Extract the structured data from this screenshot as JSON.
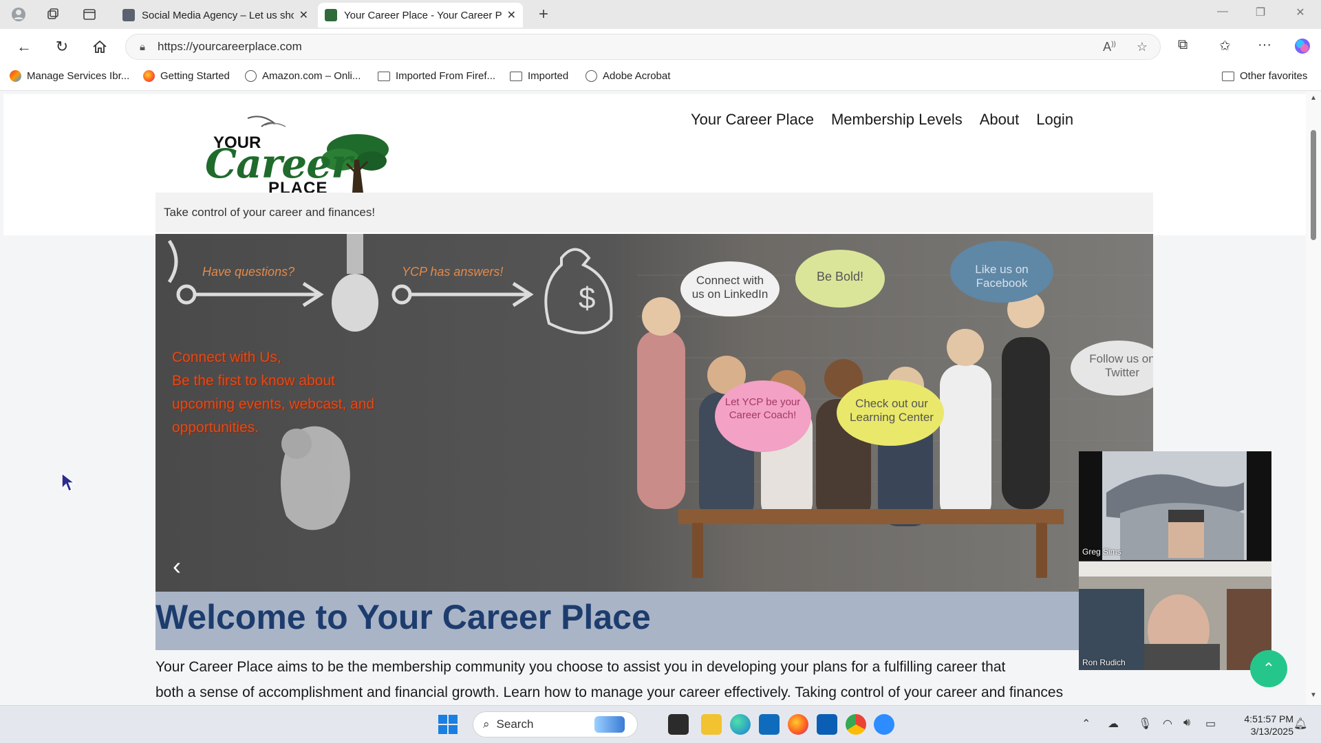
{
  "browser": {
    "tabs": [
      {
        "title": "Social Media Agency – Let us sho",
        "active": false
      },
      {
        "title": "Your Career Place - Your Career P",
        "active": true
      }
    ],
    "url": "https://yourcareerplace.com",
    "bookmarks": [
      {
        "label": "Manage Services Ibr...",
        "icon": "brand-icon"
      },
      {
        "label": "Getting Started",
        "icon": "firefox-icon"
      },
      {
        "label": "Amazon.com – Onli...",
        "icon": "globe-icon"
      },
      {
        "label": "Imported From Firef...",
        "icon": "folder-icon"
      },
      {
        "label": "Imported",
        "icon": "folder-icon"
      },
      {
        "label": "Adobe Acrobat",
        "icon": "globe-icon"
      }
    ],
    "other_favorites": "Other favorites"
  },
  "site": {
    "logo": {
      "line1": "YOUR",
      "line2": "Career",
      "line3": "PLACE"
    },
    "nav": [
      "Your Career Place",
      "Membership Levels",
      "About",
      "Login"
    ],
    "tagline": "Take control of your career and finances!",
    "hero": {
      "arrow_left_text": "Have questions?",
      "arrow_right_text": "YCP has answers!",
      "connect_lines": [
        "Connect with Us,",
        "Be the first to know about",
        "upcoming events, webcast, and",
        "opportunities."
      ],
      "bubbles": [
        "Connect with us on LinkedIn",
        "Be Bold!",
        "Like us on Facebook",
        "Follow us on Twitter",
        "Let YCP be your Career Coach!",
        "Check out our Learning Center"
      ]
    },
    "welcome_title": "Welcome to Your Career Place",
    "intro_line1": "Your Career Place aims to be the membership community you choose to assist you in developing your plans for a fulfilling career that",
    "intro_line2": "both a sense of accomplishment and financial growth. Learn how to manage your career effectively. Taking control of your career and finances"
  },
  "video_call": {
    "participants": [
      "Greg Sims",
      "Ron Rudich"
    ]
  },
  "taskbar": {
    "search_placeholder": "Search",
    "time": "4:51:57 PM",
    "date": "3/13/2025"
  },
  "colors": {
    "welcome_title": "#1d3c6e",
    "welcome_bar": "#a9b4c6",
    "hero_connect_text": "#e04a1a",
    "fab": "#25c68c"
  }
}
